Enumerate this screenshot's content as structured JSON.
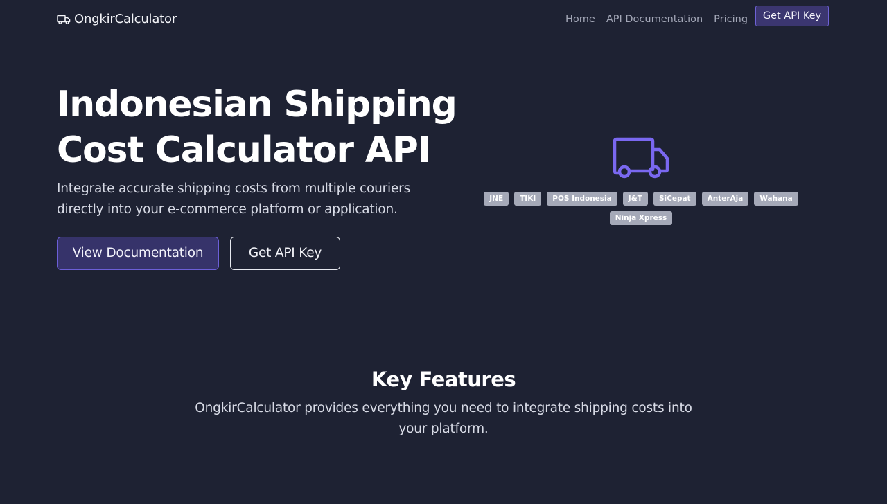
{
  "navbar": {
    "brand": "OngkirCalculator",
    "brand_icon": "truck-icon",
    "links": [
      "Home",
      "API Documentation",
      "Pricing"
    ],
    "cta": "Get API Key"
  },
  "hero": {
    "title_line1": "Indonesian Shipping",
    "title_line2": "Cost Calculator API",
    "subtitle": "Integrate accurate shipping costs from multiple couriers directly into your e-commerce platform or application.",
    "primary_button": "View Documentation",
    "secondary_button": "Get API Key"
  },
  "illustration": {
    "icon": "truck-icon",
    "couriers": [
      "JNE",
      "TIKI",
      "POS Indonesia",
      "J&T",
      "SiCepat",
      "AnterAja",
      "Wahana",
      "Ninja Xpress"
    ]
  },
  "features": {
    "title": "Key Features",
    "subtitle": "OngkirCalculator provides everything you need to integrate shipping costs into your platform."
  },
  "colors": {
    "background": "#1e2233",
    "accent": "#6c5fd8",
    "accent_fill": "#36336a",
    "badge": "#a5a9b8",
    "truck_illustration": "#7a68f0"
  }
}
